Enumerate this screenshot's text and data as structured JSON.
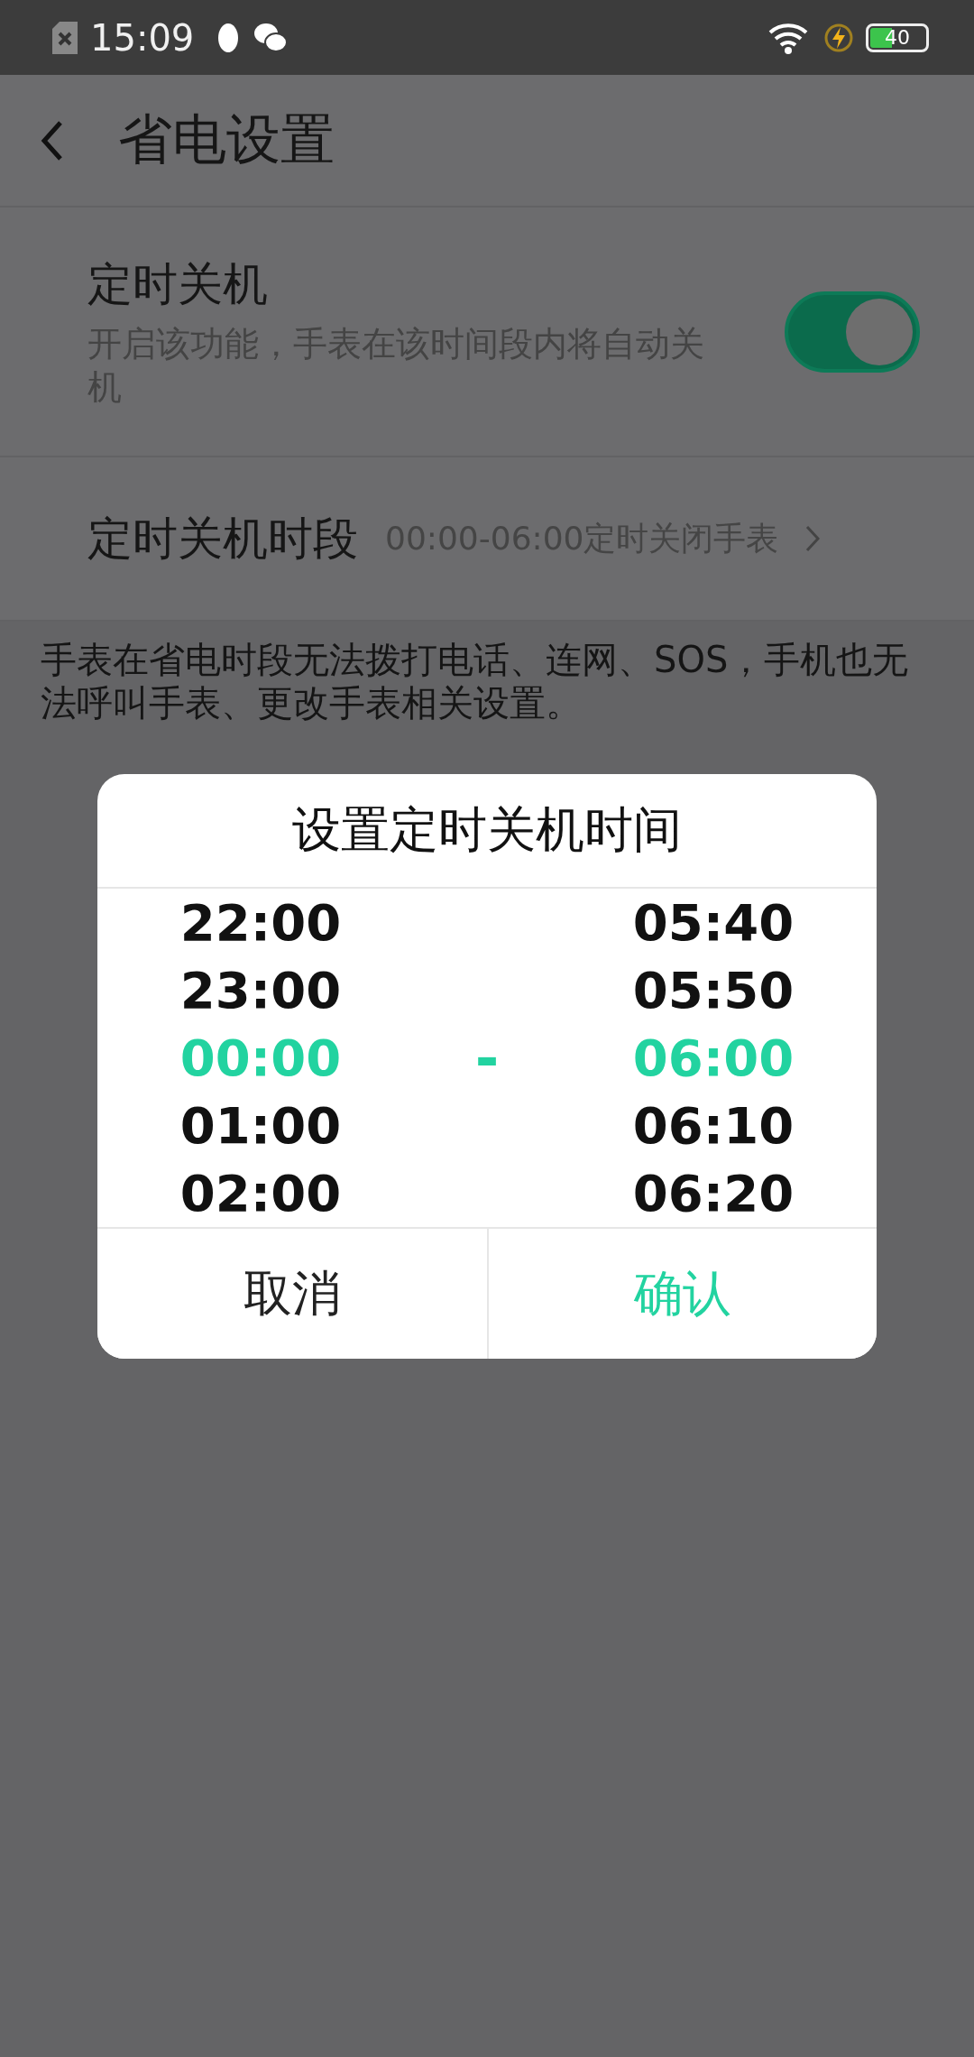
{
  "status_bar": {
    "time": "15:09",
    "battery": "40"
  },
  "header": {
    "title": "省电设置"
  },
  "settings": [
    {
      "kind": "toggle",
      "title": "定时关机",
      "subtitle": "开启该功能，手表在该时间段内将自动关机",
      "on": true
    },
    {
      "kind": "link",
      "title": "定时关机时段",
      "value": "00:00-06:00定时关闭手表"
    }
  ],
  "note": "手表在省电时段无法拨打电话、连网、SOS，手机也无法呼叫手表、更改手表相关设置。",
  "dialog": {
    "title": "设置定时关机时间",
    "separator": "-",
    "columns": [
      {
        "items": [
          {
            "label": "22:00",
            "selected": false
          },
          {
            "label": "23:00",
            "selected": false
          },
          {
            "label": "00:00",
            "selected": true
          },
          {
            "label": "01:00",
            "selected": false
          },
          {
            "label": "02:00",
            "selected": false
          }
        ]
      },
      {
        "items": [
          {
            "label": "05:40",
            "selected": false
          },
          {
            "label": "05:50",
            "selected": false
          },
          {
            "label": "06:00",
            "selected": true
          },
          {
            "label": "06:10",
            "selected": false
          },
          {
            "label": "06:20",
            "selected": false
          }
        ]
      }
    ],
    "buttons": [
      {
        "label": "取消",
        "kind": "cancel"
      },
      {
        "label": "确认",
        "kind": "confirm"
      }
    ]
  }
}
